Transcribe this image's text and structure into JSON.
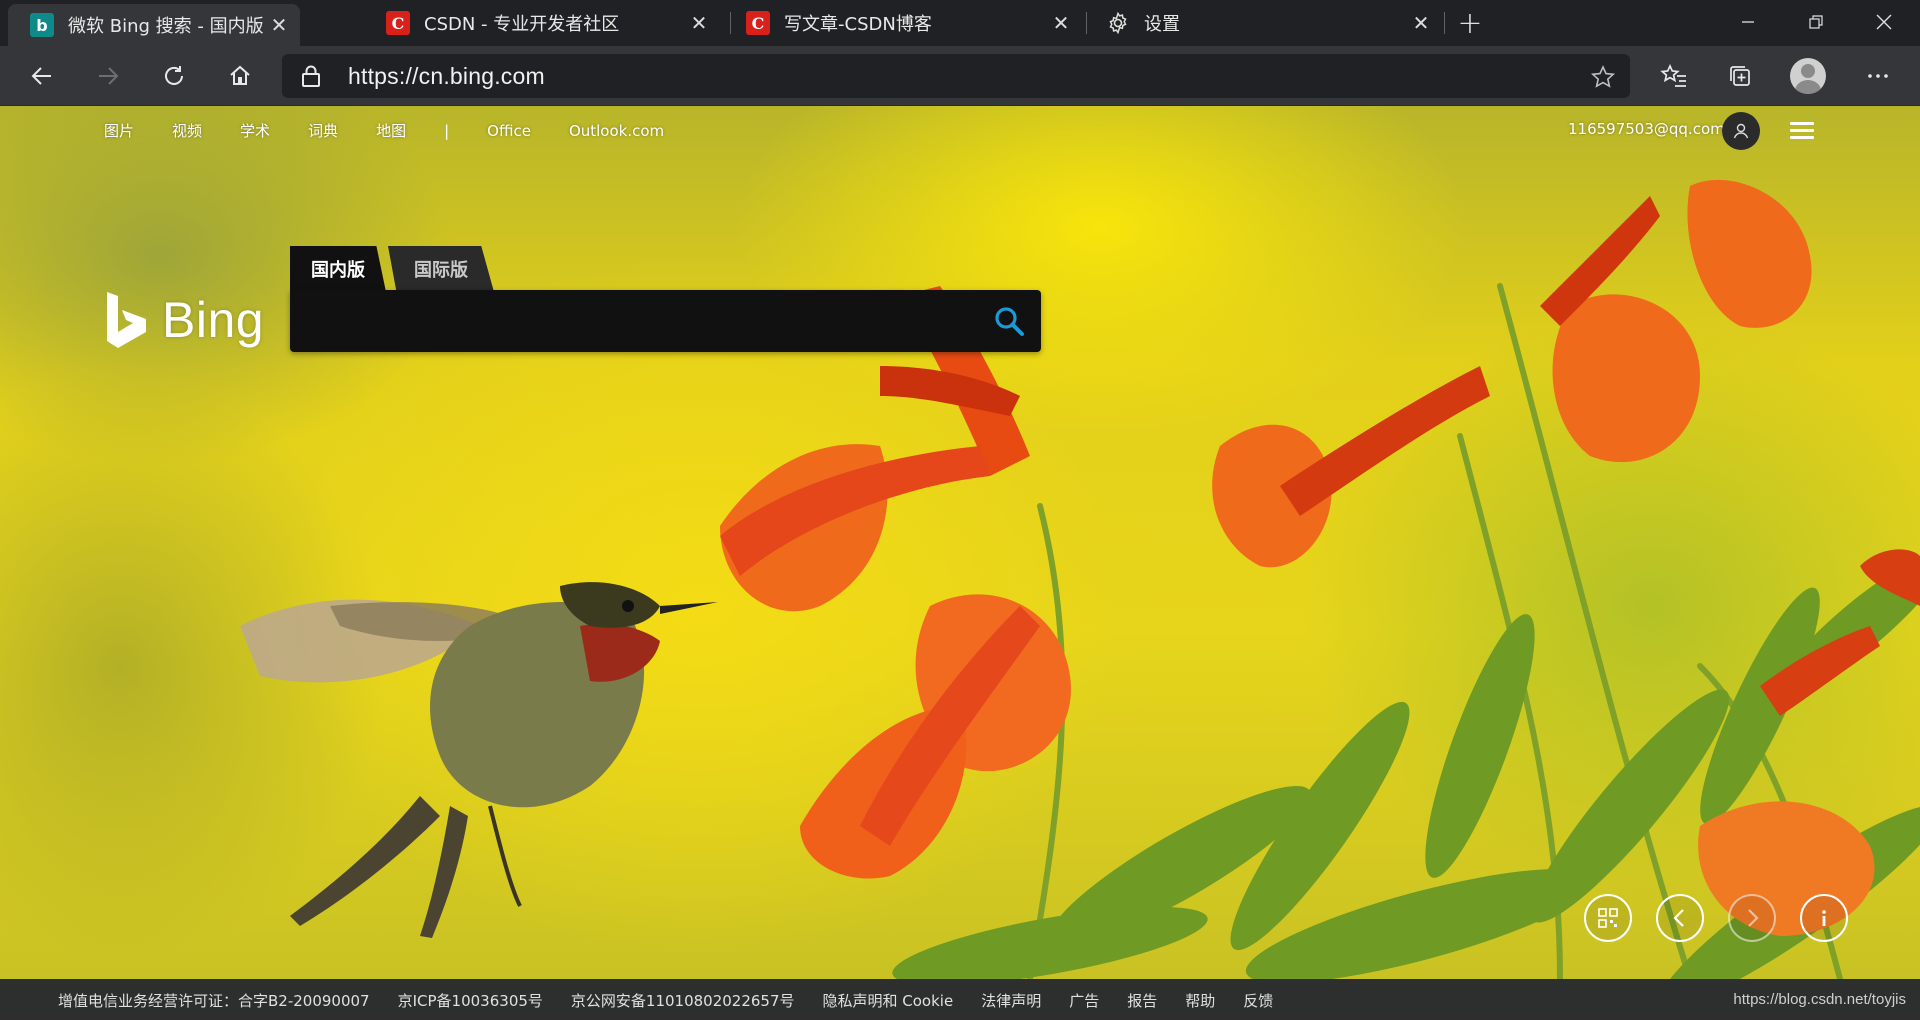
{
  "browser": {
    "tabs": [
      {
        "title": "微软 Bing 搜索 - 国内版",
        "favicon": "bing-icon",
        "active": true
      },
      {
        "title": "CSDN - 专业开发者社区",
        "favicon": "csdn-icon",
        "active": false
      },
      {
        "title": "写文章-CSDN博客",
        "favicon": "csdn-icon",
        "active": false
      },
      {
        "title": "设置",
        "favicon": "gear-icon",
        "active": false
      }
    ],
    "url": "https://cn.bing.com"
  },
  "page": {
    "nav": [
      "图片",
      "视频",
      "学术",
      "词典",
      "地图",
      "|",
      "Office",
      "Outlook.com"
    ],
    "account": "116597503@qq.com",
    "logo_text": "Bing",
    "scope_tabs": [
      "国内版",
      "国际版"
    ],
    "search": {
      "value": "",
      "placeholder": ""
    },
    "footer_links": [
      "增值电信业务经营许可证：合字B2-20090007",
      "京ICP备10036305号",
      "京公网安备11010802022657号",
      "隐私声明和 Cookie",
      "法律声明",
      "广告",
      "报告",
      "帮助",
      "反馈"
    ],
    "watermark": "https://blog.csdn.net/toyjis"
  },
  "colors": {
    "chrome_dark": "#202124",
    "chrome_toolbar": "#35363a",
    "bing_teal": "#0f8a8a",
    "csdn_red": "#d9211b",
    "search_icon": "#1b9ad6"
  }
}
